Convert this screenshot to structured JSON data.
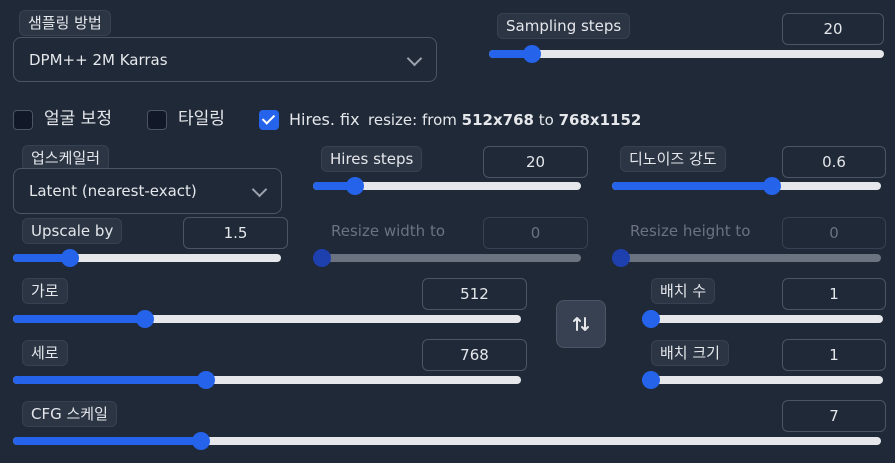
{
  "sampling_method": {
    "label": "샘플링 방법",
    "value": "DPM++ 2M Karras"
  },
  "sampling_steps": {
    "label": "Sampling steps",
    "value": "20",
    "fraction": 0.09
  },
  "checkboxes": {
    "face_restore": {
      "label": "얼굴 보정",
      "checked": false
    },
    "tiling": {
      "label": "타일링",
      "checked": false
    },
    "hires_fix": {
      "label": "Hires. fix",
      "checked": true
    }
  },
  "resize_note": {
    "prefix": "resize: from ",
    "from": "512x768",
    "middle": " to ",
    "to": "768x1152"
  },
  "upscaler": {
    "label": "업스케일러",
    "value": "Latent (nearest-exact)"
  },
  "hires_steps": {
    "label": "Hires steps",
    "value": "20",
    "fraction": 0.13
  },
  "denoise": {
    "label": "디노이즈 강도",
    "value": "0.6",
    "fraction": 0.6
  },
  "upscale_by": {
    "label": "Upscale by",
    "value": "1.5",
    "fraction": 0.19
  },
  "resize_width": {
    "label": "Resize width to",
    "value": "0",
    "fraction": 0
  },
  "resize_height": {
    "label": "Resize height to",
    "value": "0",
    "fraction": 0
  },
  "width": {
    "label": "가로",
    "value": "512",
    "fraction": 0.25
  },
  "height": {
    "label": "세로",
    "value": "768",
    "fraction": 0.375
  },
  "batch_count": {
    "label": "배치 수",
    "value": "1",
    "fraction": 0
  },
  "batch_size": {
    "label": "배치 크기",
    "value": "1",
    "fraction": 0
  },
  "cfg_scale": {
    "label": "CFG 스케일",
    "value": "7",
    "fraction": 0.21
  },
  "swap_icon": "swap-vertical-icon",
  "colors": {
    "background": "#1f2937",
    "accent": "#2563eb",
    "track": "#e5e7eb"
  }
}
